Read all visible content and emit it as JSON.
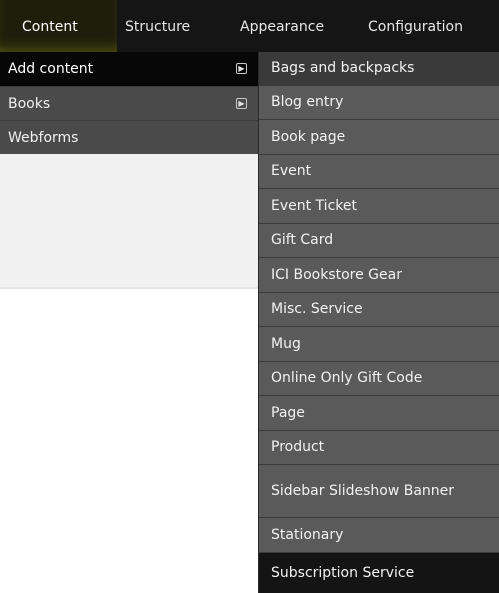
{
  "toolbar": {
    "tabs": [
      {
        "label": "Content"
      },
      {
        "label": "Structure"
      },
      {
        "label": "Appearance"
      },
      {
        "label": "Configuration"
      }
    ]
  },
  "left_menu": {
    "items": [
      {
        "label": "Add content"
      },
      {
        "label": "Books"
      },
      {
        "label": "Webforms"
      }
    ]
  },
  "submenu": {
    "items": [
      {
        "label": "Bags and backpacks"
      },
      {
        "label": "Blog entry"
      },
      {
        "label": "Book page"
      },
      {
        "label": "Event"
      },
      {
        "label": "Event Ticket"
      },
      {
        "label": "Gift Card"
      },
      {
        "label": "ICI Bookstore Gear"
      },
      {
        "label": "Misc. Service"
      },
      {
        "label": "Mug"
      },
      {
        "label": "Online Only Gift Code"
      },
      {
        "label": "Page"
      },
      {
        "label": "Product"
      },
      {
        "label": "Sidebar Slideshow Banner"
      },
      {
        "label": "Stationary"
      },
      {
        "label": "Subscription Service"
      }
    ]
  },
  "icons": {
    "submenu_arrow": "arrow-right-icon"
  }
}
